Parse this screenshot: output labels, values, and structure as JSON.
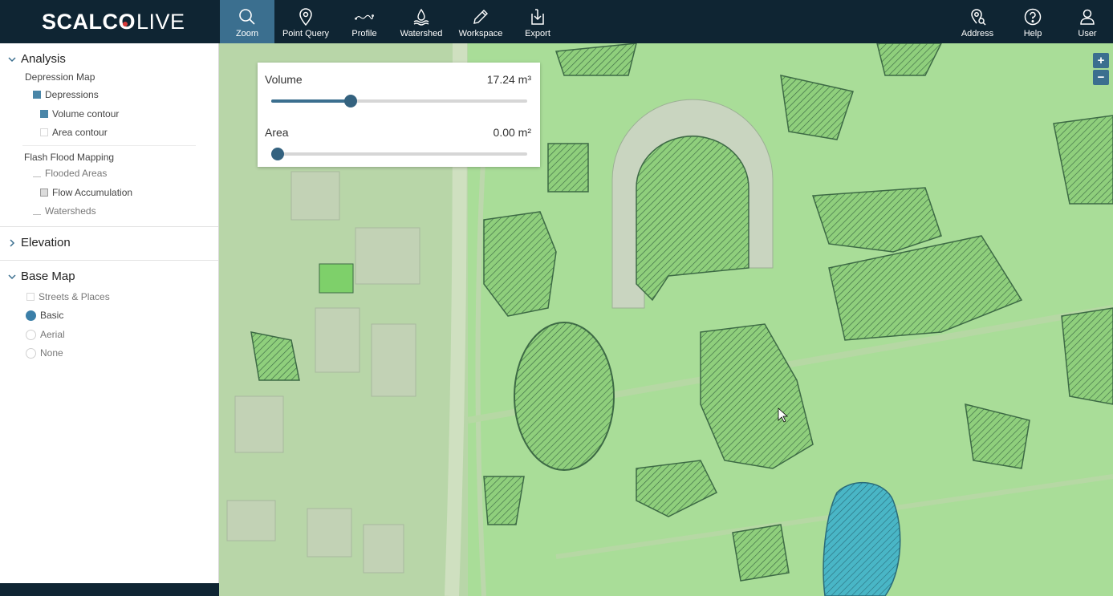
{
  "app": {
    "logo_part1": "SCALC",
    "logo_part2": "O",
    "logo_part3": "LIVE"
  },
  "toolbar": {
    "tools": [
      {
        "label": "Zoom",
        "icon": "search-icon"
      },
      {
        "label": "Point Query",
        "icon": "map-pin-icon"
      },
      {
        "label": "Profile",
        "icon": "profile-line-icon"
      },
      {
        "label": "Watershed",
        "icon": "watershed-icon"
      },
      {
        "label": "Workspace",
        "icon": "pencil-icon"
      },
      {
        "label": "Export",
        "icon": "export-icon"
      }
    ],
    "right": [
      {
        "label": "Address",
        "icon": "address-pin-icon"
      },
      {
        "label": "Help",
        "icon": "help-icon"
      },
      {
        "label": "User",
        "icon": "user-icon"
      }
    ],
    "active_tool": "Zoom"
  },
  "sidebar": {
    "analysis": {
      "title": "Analysis",
      "depression_map": "Depression Map",
      "depressions": "Depressions",
      "volume_contour": "Volume contour",
      "area_contour": "Area contour",
      "flash_flood": "Flash Flood Mapping",
      "flooded_areas": "Flooded Areas",
      "flow_accumulation": "Flow Accumulation",
      "watersheds": "Watersheds"
    },
    "elevation": {
      "title": "Elevation"
    },
    "basemap": {
      "title": "Base Map",
      "streets": "Streets & Places",
      "basic": "Basic",
      "aerial": "Aerial",
      "none": "None",
      "selected": "Basic"
    }
  },
  "panel": {
    "volume_label": "Volume",
    "volume_value": "17.24 m³",
    "volume_fraction": 0.31,
    "area_label": "Area",
    "area_value": "0.00 m²",
    "area_fraction": 0.0
  },
  "map": {
    "zoom_in": "+",
    "zoom_out": "−"
  },
  "colors": {
    "topbar": "#0f2533",
    "accent": "#3b6f8f",
    "map_green": "#a9dd98",
    "water": "#4cb8c4"
  }
}
